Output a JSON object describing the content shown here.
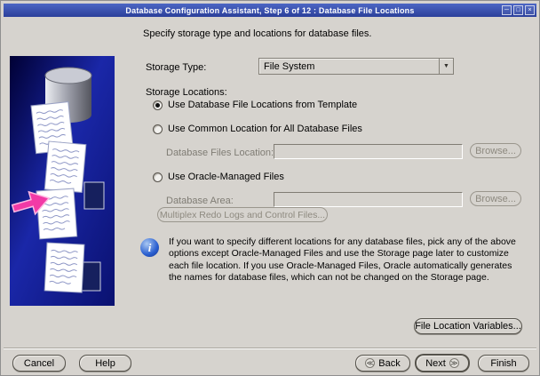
{
  "window": {
    "title": "Database Configuration Assistant, Step 6 of 12 : Database File Locations",
    "minimize_icon": "─",
    "maximize_icon": "□",
    "close_icon": "×"
  },
  "content": {
    "instruction": "Specify storage type and locations for database files.",
    "storage_type": {
      "label": "Storage Type:",
      "value": "File System",
      "dropdown_icon": "▼"
    },
    "storage_locations_label": "Storage Locations:",
    "options": {
      "template": {
        "label": "Use Database File Locations from Template",
        "selected": true
      },
      "common": {
        "label": "Use Common Location for All Database Files",
        "selected": false
      },
      "omf": {
        "label": "Use Oracle-Managed Files",
        "selected": false
      }
    },
    "database_files_location": {
      "label": "Database Files Location:",
      "value": "",
      "browse_label": "Browse..."
    },
    "database_area": {
      "label": "Database Area:",
      "value": "",
      "browse_label": "Browse..."
    },
    "multiplex_button_label": "Multiplex Redo Logs and Control Files...",
    "info_icon_glyph": "i",
    "info_text": "If you want to specify different locations for any database files, pick any of the above options except Oracle-Managed Files and use the Storage page later to customize each file location. If you use Oracle-Managed Files, Oracle automatically generates the names for database files, which can not be changed on the Storage page.",
    "file_location_variables_label": "File Location Variables..."
  },
  "footer": {
    "cancel": "Cancel",
    "help": "Help",
    "back": "Back",
    "back_icon": "≪",
    "next": "Next",
    "next_icon": "≫",
    "finish": "Finish"
  }
}
